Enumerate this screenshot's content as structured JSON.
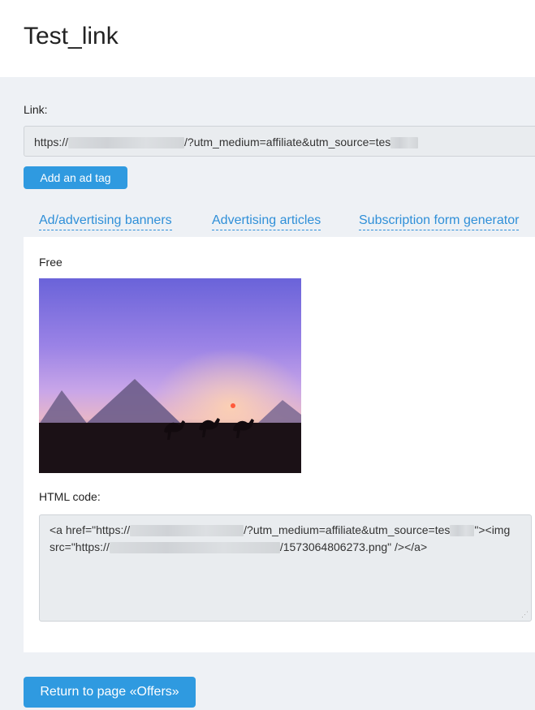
{
  "page": {
    "title": "Test_link"
  },
  "link": {
    "label": "Link:",
    "prefix": "https://",
    "suffix": "/?utm_medium=affiliate&utm_source=tes"
  },
  "buttons": {
    "add_ad_tag": "Add an ad tag",
    "return": "Return to page «Offers»"
  },
  "tabs": [
    {
      "label": "Ad/advertising banners"
    },
    {
      "label": "Advertising articles"
    },
    {
      "label": "Subscription form generator"
    }
  ],
  "banner": {
    "label": "Free"
  },
  "html_code": {
    "label": "HTML code:",
    "part1": "<a href=\"https://",
    "part2": "/?utm_medium=affiliate&utm_source=tes",
    "part3": "\"><img",
    "part4": "src=\"https://",
    "part5": "/1573064806273.png\" /></a>"
  },
  "colors": {
    "accent": "#2f9ae0",
    "link": "#2f8fd8",
    "background": "#eef1f5"
  }
}
